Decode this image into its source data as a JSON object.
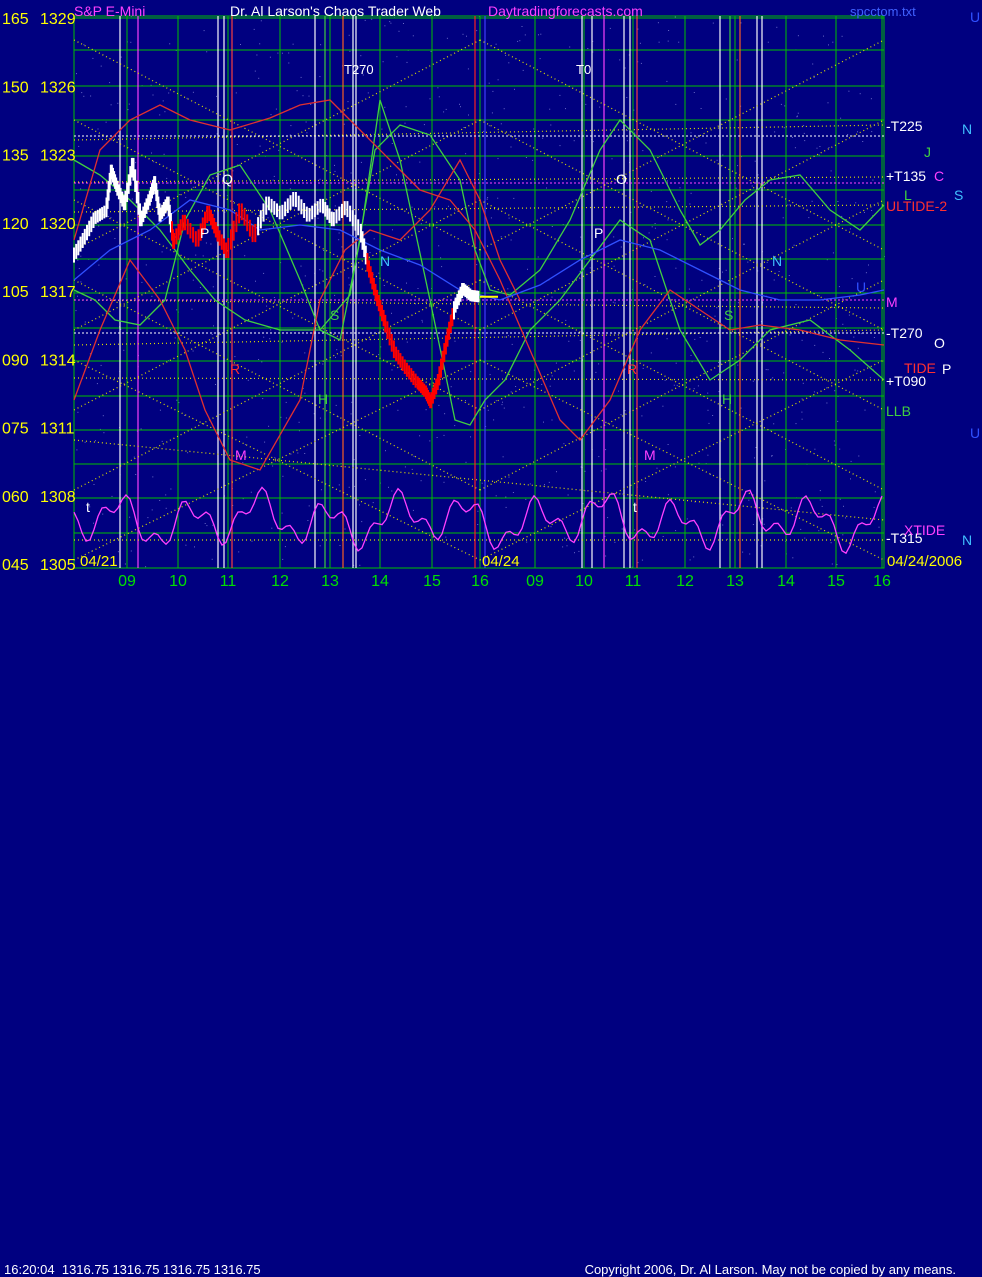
{
  "header": {
    "instrument": "S&P E-Mini",
    "title": "Dr. Al Larson's Chaos Trader Web",
    "site": "Daytradingforecasts.com",
    "file": "spcctom.txt"
  },
  "footer": {
    "time": "16:20:04",
    "quote": "1316.75 1316.75 1316.75 1316.75",
    "copyright": "Copyright 2006, Dr. Al Larson. May not be copied by any means."
  },
  "colors": {
    "background": "#000080",
    "grid_green": "#00c000",
    "yellow_dots": "#e0e000",
    "price_up": "#ffffff",
    "price_down": "#ff0000",
    "magenta": "#ff40ff",
    "green_line": "#40d040",
    "red_line": "#e03030",
    "blue_line": "#3050ff"
  },
  "chart_data": {
    "type": "line",
    "y_ticks": [
      {
        "osc": "165",
        "price": "1329"
      },
      {
        "osc": "150",
        "price": "1326"
      },
      {
        "osc": "135",
        "price": "1323"
      },
      {
        "osc": "120",
        "price": "1320"
      },
      {
        "osc": "105",
        "price": "1317"
      },
      {
        "osc": "090",
        "price": "1314"
      },
      {
        "osc": "075",
        "price": "1311"
      },
      {
        "osc": "060",
        "price": "1308"
      },
      {
        "osc": "045",
        "price": "1305"
      }
    ],
    "ylim": [
      1305,
      1329
    ],
    "x_ticks": [
      "09",
      "10",
      "11",
      "12",
      "13",
      "14",
      "15",
      "16",
      "09",
      "10",
      "11",
      "12",
      "13",
      "14",
      "15",
      "16"
    ],
    "date_labels": [
      "04/21",
      "04/24",
      "04/24/2006"
    ],
    "series": [
      {
        "name": "S&P E-Mini",
        "values": [
          [
            8.5,
            1318.5
          ],
          [
            8.7,
            1319.3
          ],
          [
            8.9,
            1320.2
          ],
          [
            9.1,
            1320.5
          ],
          [
            9.2,
            1322.3
          ],
          [
            9.3,
            1321.6
          ],
          [
            9.45,
            1320.8
          ],
          [
            9.6,
            1322.6
          ],
          [
            9.75,
            1320.1
          ],
          [
            9.9,
            1321.0
          ],
          [
            10.0,
            1321.8
          ],
          [
            10.1,
            1320.3
          ],
          [
            10.25,
            1320.9
          ],
          [
            10.35,
            1319.1
          ],
          [
            10.55,
            1320.1
          ],
          [
            10.8,
            1319.2
          ],
          [
            11.0,
            1320.5
          ],
          [
            11.15,
            1319.6
          ],
          [
            11.35,
            1318.7
          ],
          [
            11.6,
            1320.6
          ],
          [
            11.85,
            1319.4
          ],
          [
            12.1,
            1320.9
          ],
          [
            12.35,
            1320.4
          ],
          [
            12.6,
            1321.1
          ],
          [
            12.85,
            1320.3
          ],
          [
            13.1,
            1320.8
          ],
          [
            13.3,
            1320.1
          ],
          [
            13.55,
            1320.7
          ],
          [
            13.8,
            1319.7
          ],
          [
            13.95,
            1318.1
          ],
          [
            14.1,
            1316.8
          ],
          [
            14.25,
            1315.7
          ],
          [
            14.45,
            1314.3
          ],
          [
            14.65,
            1313.6
          ],
          [
            14.85,
            1313.0
          ],
          [
            15.0,
            1312.6
          ],
          [
            15.1,
            1312.1
          ],
          [
            15.25,
            1313.1
          ],
          [
            15.4,
            1314.8
          ],
          [
            15.55,
            1316.3
          ],
          [
            15.7,
            1317.1
          ],
          [
            15.85,
            1316.8
          ],
          [
            16.0,
            1316.75
          ]
        ]
      }
    ]
  },
  "labels": {
    "top_markers": [
      "T270",
      "T0"
    ],
    "cycle_letters": [
      "Q",
      "P",
      "N",
      "S",
      "H",
      "R",
      "M",
      "O",
      "P",
      "N",
      "S",
      "H",
      "R",
      "M",
      "t",
      "t"
    ],
    "right_labels": [
      {
        "text": "-T225",
        "color": "#ffffff"
      },
      {
        "text": "N",
        "color": "#40c0ff"
      },
      {
        "text": "J",
        "color": "#40d040"
      },
      {
        "text": "+T135",
        "color": "#ffffff"
      },
      {
        "text": "C",
        "color": "#ff40ff"
      },
      {
        "text": "L",
        "color": "#40d040"
      },
      {
        "text": "S",
        "color": "#40c0ff"
      },
      {
        "text": "ULTIDE-2",
        "color": "#ff3030"
      },
      {
        "text": "U",
        "color": "#3050ff"
      },
      {
        "text": "M",
        "color": "#ff40ff"
      },
      {
        "text": "-T270",
        "color": "#ffffff"
      },
      {
        "text": "O",
        "color": "#ffffff"
      },
      {
        "text": "TIDE",
        "color": "#ff3030"
      },
      {
        "text": "P",
        "color": "#ffffff"
      },
      {
        "text": "+T090",
        "color": "#ffffff"
      },
      {
        "text": "LLB",
        "color": "#40d040"
      },
      {
        "text": "U",
        "color": "#3050ff"
      },
      {
        "text": "-T315",
        "color": "#ffffff"
      },
      {
        "text": "XTIDE",
        "color": "#ff40ff"
      },
      {
        "text": "N",
        "color": "#40c0ff"
      },
      {
        "text": "U",
        "color": "#3050ff"
      }
    ]
  }
}
